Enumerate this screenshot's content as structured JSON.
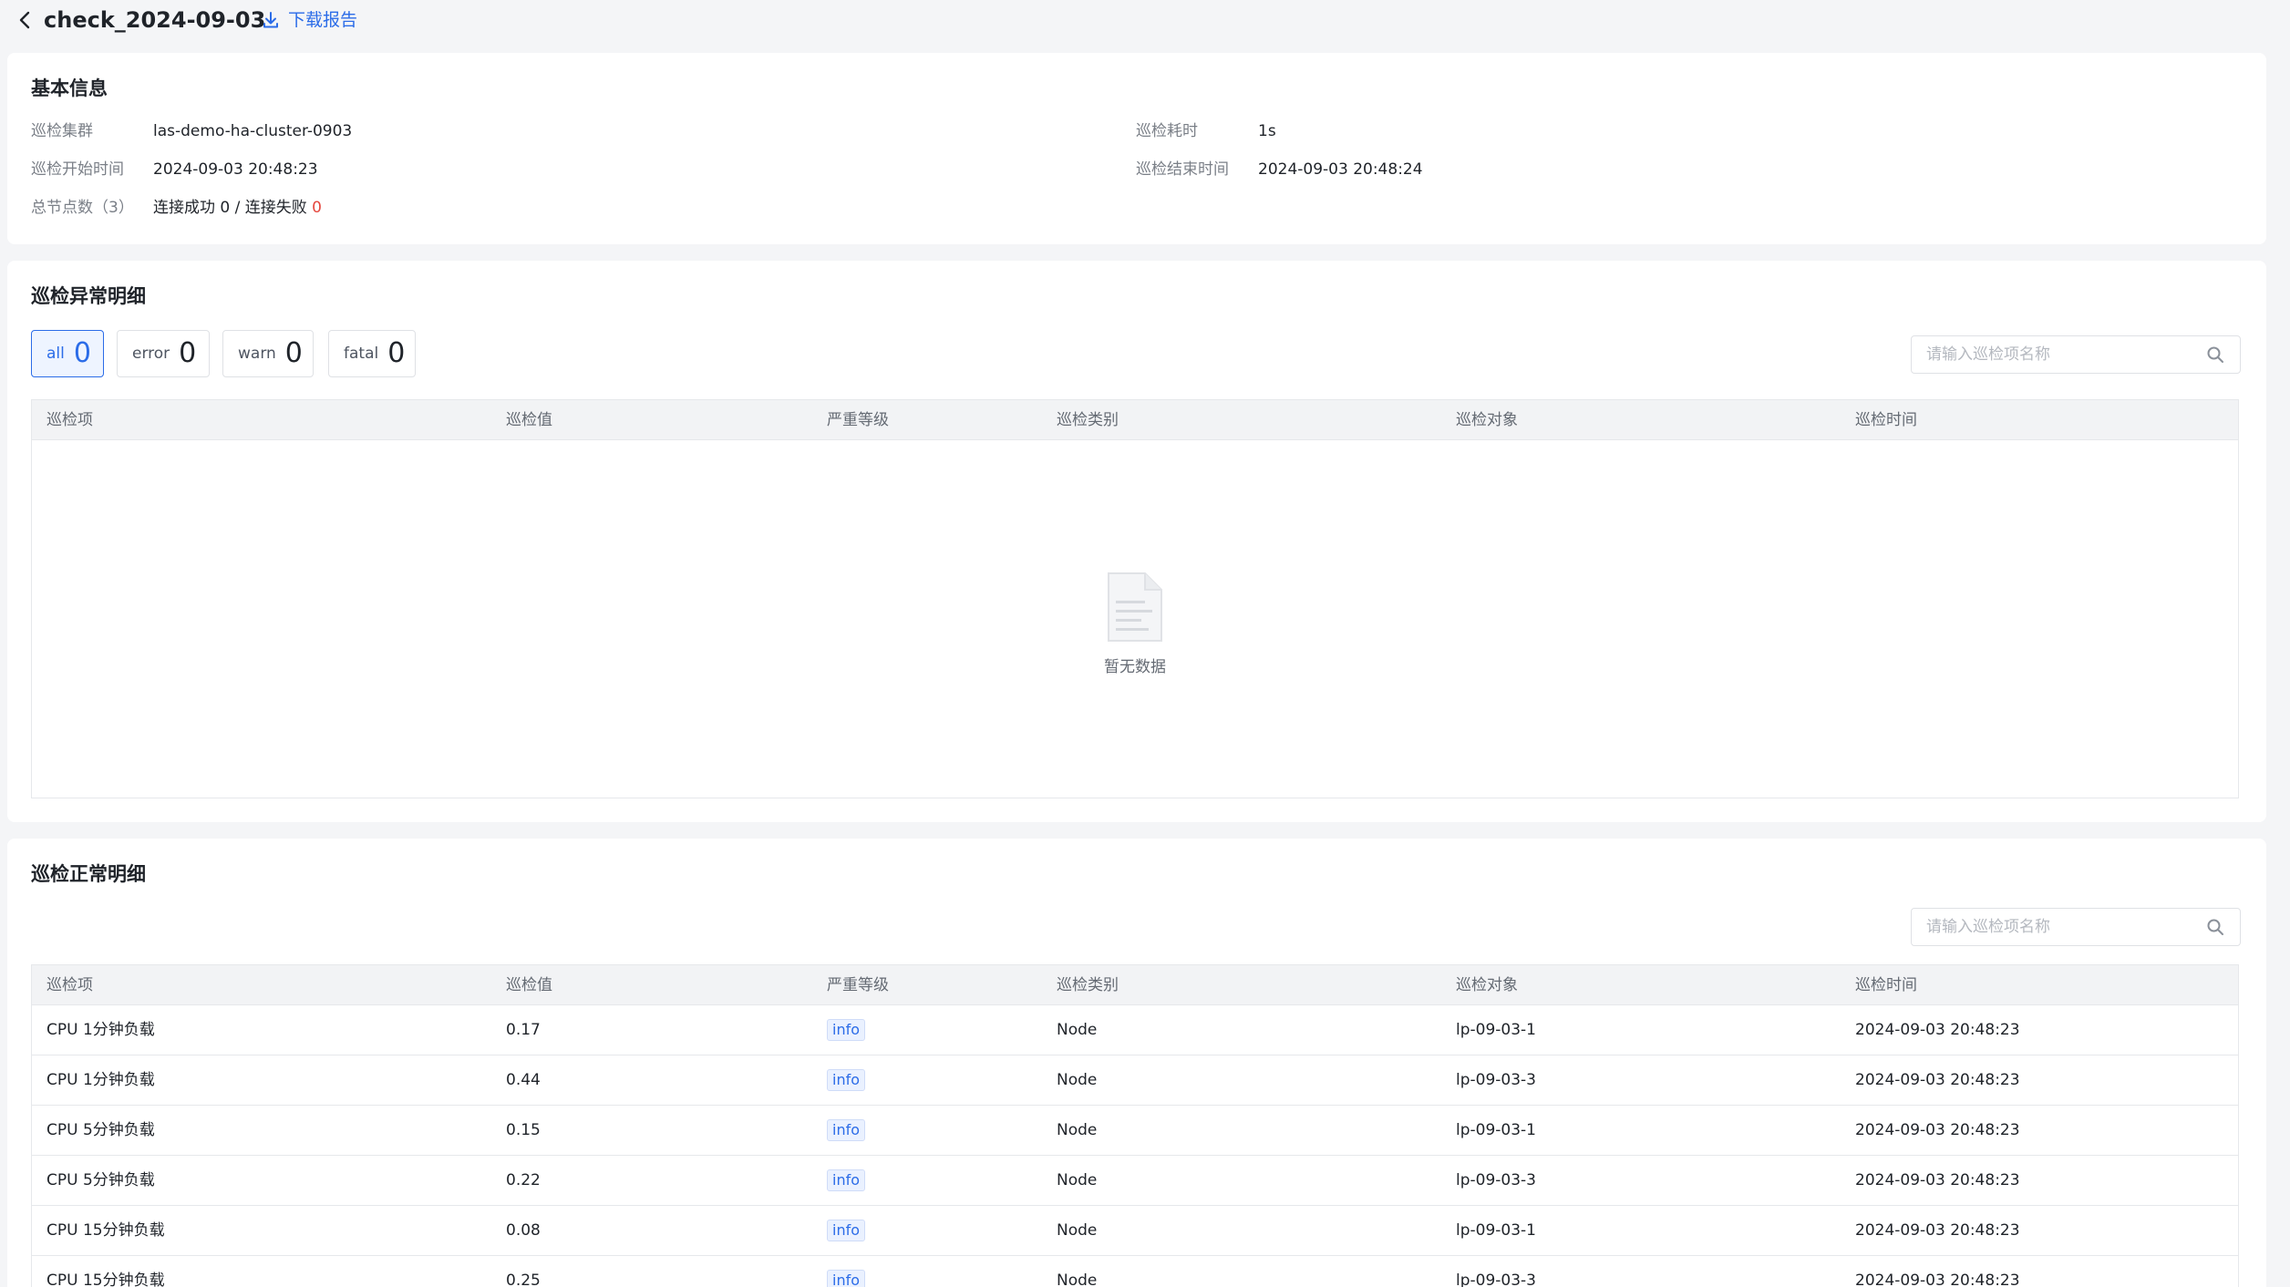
{
  "header": {
    "title": "check_2024-09-03",
    "download_label": "下载报告"
  },
  "basic": {
    "title": "基本信息",
    "cluster_label": "巡检集群",
    "cluster_value": "las-demo-ha-cluster-0903",
    "duration_label": "巡检耗时",
    "duration_value": "1s",
    "start_label": "巡检开始时间",
    "start_value": "2024-09-03 20:48:23",
    "end_label": "巡检结束时间",
    "end_value": "2024-09-03 20:48:24",
    "nodes_label": "总节点数（3）",
    "nodes_value_prefix": "连接成功 0 / 连接失败 ",
    "nodes_fail": "0"
  },
  "abnormal": {
    "title": "巡检异常明细",
    "tabs": [
      {
        "label": "all",
        "count": "0"
      },
      {
        "label": "error",
        "count": "0"
      },
      {
        "label": "warn",
        "count": "0"
      },
      {
        "label": "fatal",
        "count": "0"
      }
    ],
    "search_placeholder": "请输入巡检项名称",
    "columns": [
      "巡检项",
      "巡检值",
      "严重等级",
      "巡检类别",
      "巡检对象",
      "巡检时间"
    ],
    "empty_text": "暂无数据"
  },
  "normal": {
    "title": "巡检正常明细",
    "search_placeholder": "请输入巡检项名称",
    "columns": [
      "巡检项",
      "巡检值",
      "严重等级",
      "巡检类别",
      "巡检对象",
      "巡检时间"
    ],
    "rows": [
      {
        "item": "CPU 1分钟负载",
        "value": "0.17",
        "level": "info",
        "category": "Node",
        "target": "lp-09-03-1",
        "time": "2024-09-03 20:48:23"
      },
      {
        "item": "CPU 1分钟负载",
        "value": "0.44",
        "level": "info",
        "category": "Node",
        "target": "lp-09-03-3",
        "time": "2024-09-03 20:48:23"
      },
      {
        "item": "CPU 5分钟负载",
        "value": "0.15",
        "level": "info",
        "category": "Node",
        "target": "lp-09-03-1",
        "time": "2024-09-03 20:48:23"
      },
      {
        "item": "CPU 5分钟负载",
        "value": "0.22",
        "level": "info",
        "category": "Node",
        "target": "lp-09-03-3",
        "time": "2024-09-03 20:48:23"
      },
      {
        "item": "CPU 15分钟负载",
        "value": "0.08",
        "level": "info",
        "category": "Node",
        "target": "lp-09-03-1",
        "time": "2024-09-03 20:48:23"
      },
      {
        "item": "CPU 15分钟负载",
        "value": "0.25",
        "level": "info",
        "category": "Node",
        "target": "lp-09-03-3",
        "time": "2024-09-03 20:48:23"
      }
    ]
  }
}
